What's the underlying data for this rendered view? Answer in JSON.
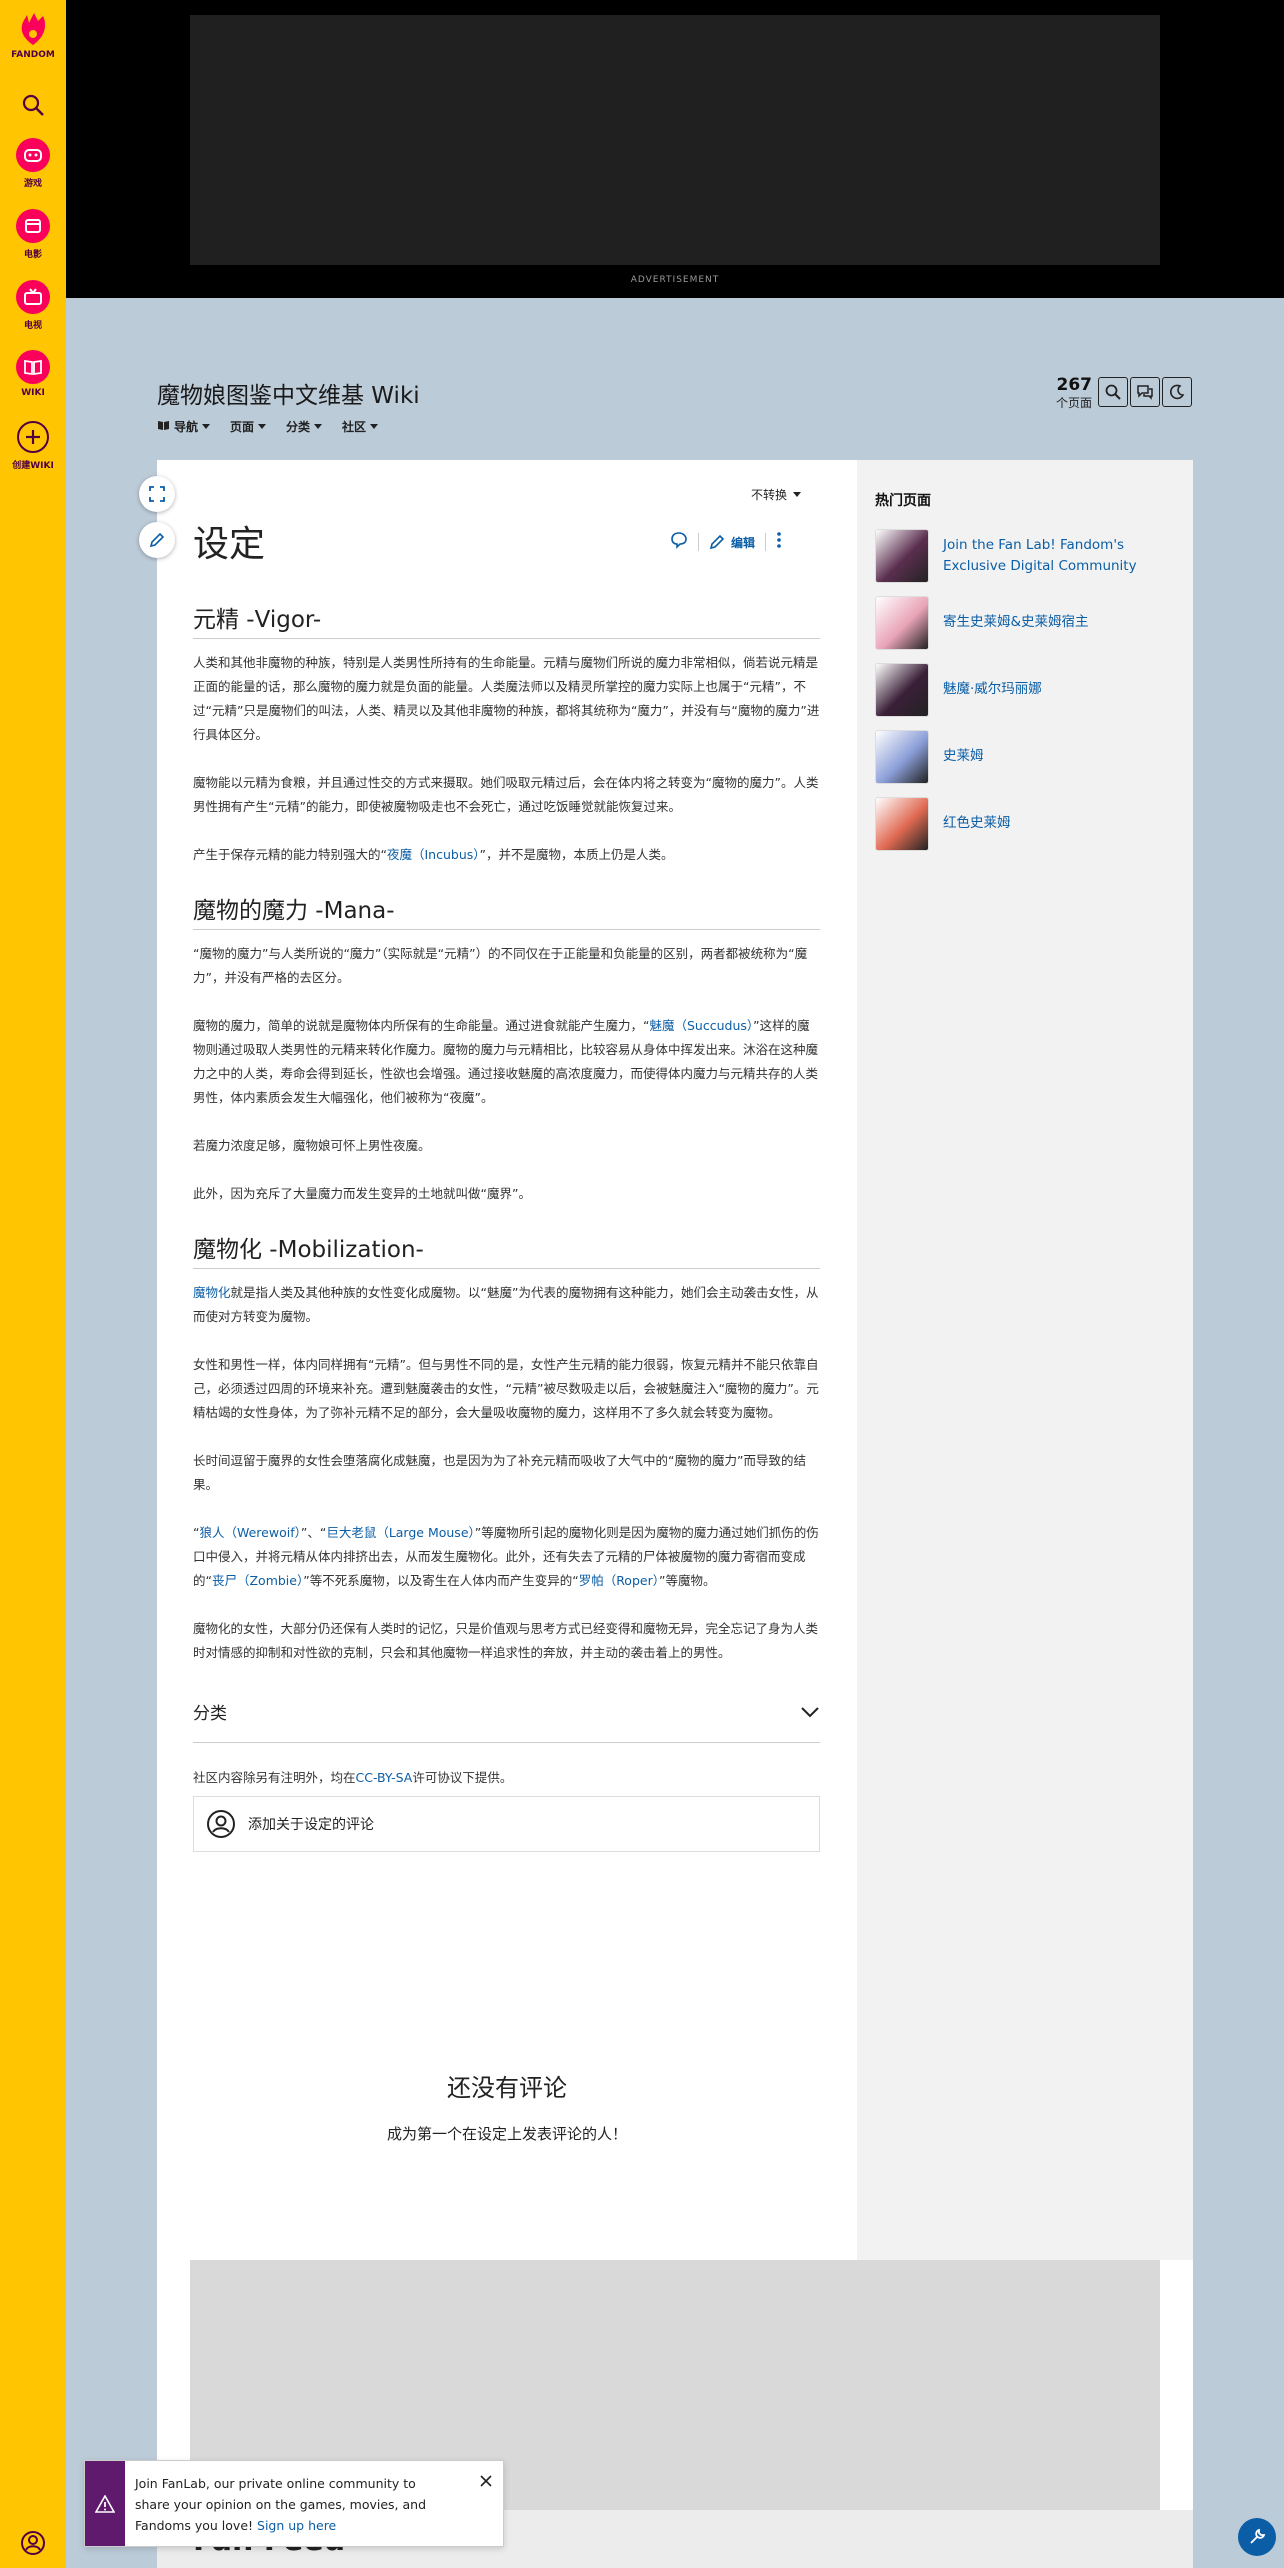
{
  "rail": {
    "logo_label": "FANDOM",
    "items": [
      {
        "label": "游戏"
      },
      {
        "label": "电影"
      },
      {
        "label": "电视"
      },
      {
        "label": "WIKI"
      },
      {
        "label": "创建WIKI"
      }
    ]
  },
  "ad": {
    "label": "ADVERTISEMENT"
  },
  "header": {
    "title": "魔物娘图鉴中文维基 Wiki",
    "page_count": "267",
    "page_count_label": "个页面",
    "nav": [
      {
        "label": "导航"
      },
      {
        "label": "页面"
      },
      {
        "label": "分类"
      },
      {
        "label": "社区"
      }
    ]
  },
  "article": {
    "variant_label": "不转换",
    "title": "设定",
    "edit_label": "编辑",
    "sections": [
      {
        "heading": "元精 -Vigor-",
        "paragraphs": [
          [
            {
              "t": "人类和其他非魔物的种族，特别是人类男性所持有的生命能量。元精与魔物们所说的魔力非常相似，倘若说元精是正面的能量的话，那么魔物的魔力就是负面的能量。人类魔法师以及精灵所掌控的魔力实际上也属于“元精”，不过“元精”只是魔物们的叫法，人类、精灵以及其他非魔物的种族，都将其统称为“魔力”，并没有与“魔物的魔力”进行具体区分。"
            }
          ],
          [
            {
              "t": "魔物能以元精为食粮，并且通过性交的方式来摄取。她们吸取元精过后，会在体内将之转变为“魔物的魔力”。人类男性拥有产生“元精”的能力，即使被魔物吸走也不会死亡，通过吃饭睡觉就能恢复过来。"
            }
          ],
          [
            {
              "t": "产生于保存元精的能力特别强大的“"
            },
            {
              "t": "夜魔（Incubus）",
              "link": true
            },
            {
              "t": "”，并不是魔物，本质上仍是人类。"
            }
          ]
        ]
      },
      {
        "heading": "魔物的魔力 -Mana-",
        "paragraphs": [
          [
            {
              "t": "“魔物的魔力”与人类所说的“魔力”（实际就是“元精”）的不同仅在于正能量和负能量的区别，两者都被统称为“魔力”，并没有严格的去区分。"
            }
          ],
          [
            {
              "t": "魔物的魔力，简单的说就是魔物体内所保有的生命能量。通过进食就能产生魔力，“"
            },
            {
              "t": "魅魔（Succudus）",
              "link": true
            },
            {
              "t": "”这样的魔物则通过吸取人类男性的元精来转化作魔力。魔物的魔力与元精相比，比较容易从身体中挥发出来。沐浴在这种魔力之中的人类，寿命会得到延长，性欲也会增强。通过接收魅魔的高浓度魔力，而使得体内魔力与元精共存的人类男性，体内素质会发生大幅强化，他们被称为“夜魔”。"
            }
          ],
          [
            {
              "t": "若魔力浓度足够，魔物娘可怀上男性夜魔。"
            }
          ],
          [
            {
              "t": "此外，因为充斥了大量魔力而发生变异的土地就叫做“魔界”。"
            }
          ]
        ]
      },
      {
        "heading": "魔物化 -Mobilization-",
        "paragraphs": [
          [
            {
              "t": "魔物化",
              "link": true
            },
            {
              "t": "就是指人类及其他种族的女性变化成魔物。以“魅魔”为代表的魔物拥有这种能力，她们会主动袭击女性，从而使对方转变为魔物。"
            }
          ],
          [
            {
              "t": "女性和男性一样，体内同样拥有“元精”。但与男性不同的是，女性产生元精的能力很弱，恢复元精并不能只依靠自己，必须透过四周的环境来补充。遭到魅魔袭击的女性，“元精”被尽数吸走以后，会被魅魔注入“魔物的魔力”。元精枯竭的女性身体，为了弥补元精不足的部分，会大量吸收魔物的魔力，这样用不了多久就会转变为魔物。"
            }
          ],
          [
            {
              "t": "长时间逗留于魔界的女性会堕落腐化成魅魔，也是因为为了补充元精而吸收了大气中的“魔物的魔力”而导致的结果。"
            }
          ],
          [
            {
              "t": "“"
            },
            {
              "t": "狼人（Werewoif）",
              "link": true
            },
            {
              "t": "”、“"
            },
            {
              "t": "巨大老鼠（Large Mouse）",
              "link": true
            },
            {
              "t": "”等魔物所引起的魔物化则是因为魔物的魔力通过她们抓伤的伤口中侵入，并将元精从体内排挤出去，从而发生魔物化。此外，还有失去了元精的尸体被魔物的魔力寄宿而变成的“"
            },
            {
              "t": "丧尸（Zombie）",
              "link": true
            },
            {
              "t": "”等不死系魔物，以及寄生在人体内而产生变异的“"
            },
            {
              "t": "罗帕（Roper）",
              "link": true
            },
            {
              "t": "”等魔物。"
            }
          ],
          [
            {
              "t": "魔物化的女性，大部分仍还保有人类时的记忆，只是价值观与思考方式已经变得和魔物无异，完全忘记了身为人类时对情感的抑制和对性欲的克制，只会和其他魔物一样追求性的奔放，并主动的袭击着上的男性。"
            }
          ]
        ]
      }
    ],
    "categories_label": "分类",
    "license_prefix": "社区内容除另有注明外，均在",
    "license_link": "CC-BY-SA",
    "license_suffix": "许可协议下提供。",
    "add_comment": "添加关于设定的评论"
  },
  "comments": {
    "empty_title": "还没有评论",
    "empty_subtitle": "成为第一个在设定上发表评论的人！"
  },
  "popular": {
    "heading": "热门页面",
    "items": [
      {
        "label": "Join the Fan Lab! Fandom's Exclusive Digital Community",
        "color": "#5b2f4f"
      },
      {
        "label": "寄生史莱姆&史莱姆宿主",
        "color": "#e9a4b8"
      },
      {
        "label": "魅魔·威尔玛丽娜",
        "color": "#3a2038"
      },
      {
        "label": "史莱姆",
        "color": "#8b9ed8"
      },
      {
        "label": "红色史莱姆",
        "color": "#e06a52"
      }
    ]
  },
  "fan_feed": {
    "title": "Fan Feed"
  },
  "toast": {
    "text": "Join FanLab, our private online community to share your opinion on the games, movies, and Fandoms you love!",
    "link": "Sign up here"
  },
  "colors": {
    "accent": "#0b5ea6",
    "rail": "#ffc500",
    "brand": "#fa005a"
  }
}
